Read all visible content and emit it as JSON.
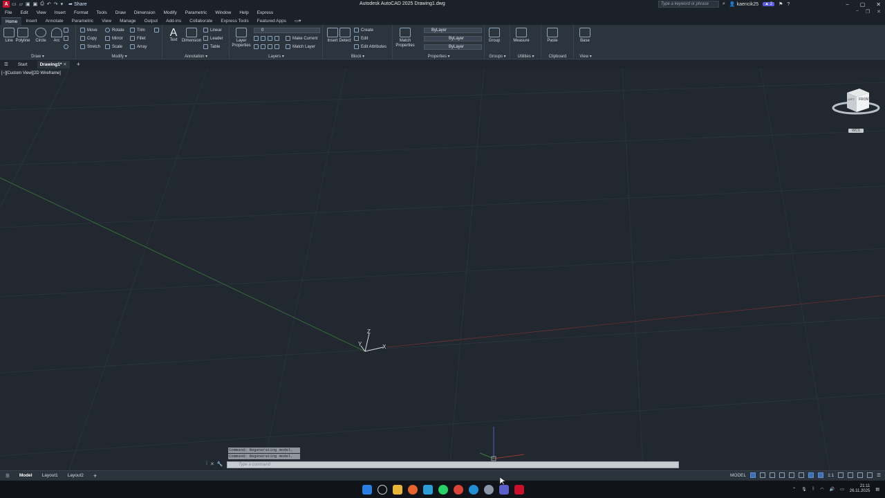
{
  "titlebar": {
    "app_title": "Autodesk AutoCAD 2025   Drawing1.dwg",
    "share_label": "Share",
    "search_placeholder": "Type a keyword or phrase",
    "user": "kaencik25",
    "badge": "2",
    "logo_letter": "A"
  },
  "menu": [
    "File",
    "Edit",
    "View",
    "Insert",
    "Format",
    "Tools",
    "Draw",
    "Dimension",
    "Modify",
    "Parametric",
    "Window",
    "Help",
    "Express"
  ],
  "ribbon_tabs": [
    "Home",
    "Insert",
    "Annotate",
    "Parametric",
    "View",
    "Manage",
    "Output",
    "Add-ins",
    "Collaborate",
    "Express Tools",
    "Featured Apps"
  ],
  "ribbon": {
    "draw": {
      "title": "Draw ▾",
      "line": "Line",
      "polyline": "Polyline",
      "circle": "Circle",
      "arc": "Arc"
    },
    "modify": {
      "title": "Modify ▾",
      "move": "Move",
      "rotate": "Rotate",
      "trim": "Trim",
      "copy": "Copy",
      "mirror": "Mirror",
      "fillet": "Fillet",
      "stretch": "Stretch",
      "scale": "Scale",
      "array": "Array"
    },
    "annotation": {
      "title": "Annotation ▾",
      "text": "Text",
      "dimension": "Dimension",
      "linear": "Linear",
      "leader": "Leader",
      "table": "Table"
    },
    "layers": {
      "title": "Layers ▾",
      "layer_properties": "Layer Properties",
      "current_layer": "0",
      "make_current": "Make Current",
      "match_layer": "Match Layer"
    },
    "block": {
      "title": "Block ▾",
      "insert": "Insert",
      "detect": "Detect",
      "create": "Create",
      "edit": "Edit",
      "edit_attributes": "Edit Attributes"
    },
    "properties": {
      "title": "Properties ▾",
      "match_properties": "Match Properties",
      "color": "ByLayer",
      "linetype": "ByLayer",
      "lineweight": "ByLayer"
    },
    "groups": {
      "title": "Groups ▾",
      "group": "Group"
    },
    "utilities": {
      "title": "Utilities ▾",
      "measure": "Measure"
    },
    "clipboard": {
      "title": "Clipboard",
      "paste": "Paste"
    },
    "view": {
      "title": "View ▾",
      "base": "Base"
    }
  },
  "doc_tabs": {
    "start": "Start",
    "drawing": "Drawing1*"
  },
  "viewport": {
    "label": "[−][Custom View][2D Wireframe]",
    "ucs": {
      "x": "X",
      "y": "Y",
      "z": "Z"
    },
    "viewcube_face": "FRONT",
    "viewcube_side": "LEFT",
    "wcs": "WCS"
  },
  "command": {
    "history": [
      "Command:  Regenerating model.",
      "Command:  Regenerating model."
    ],
    "placeholder": "Type a command"
  },
  "status": {
    "layouts": [
      "Model",
      "Layout1",
      "Layout2"
    ],
    "mode": "MODEL",
    "scale": "1:1"
  },
  "clock": {
    "time": "21:11",
    "date": "26.11.2025"
  },
  "colors": {
    "background": "#212830",
    "ribbon": "#2c343e",
    "accent": "#5b5ce2",
    "x_axis": "#b83b3b",
    "y_axis": "#3a8a3a"
  }
}
